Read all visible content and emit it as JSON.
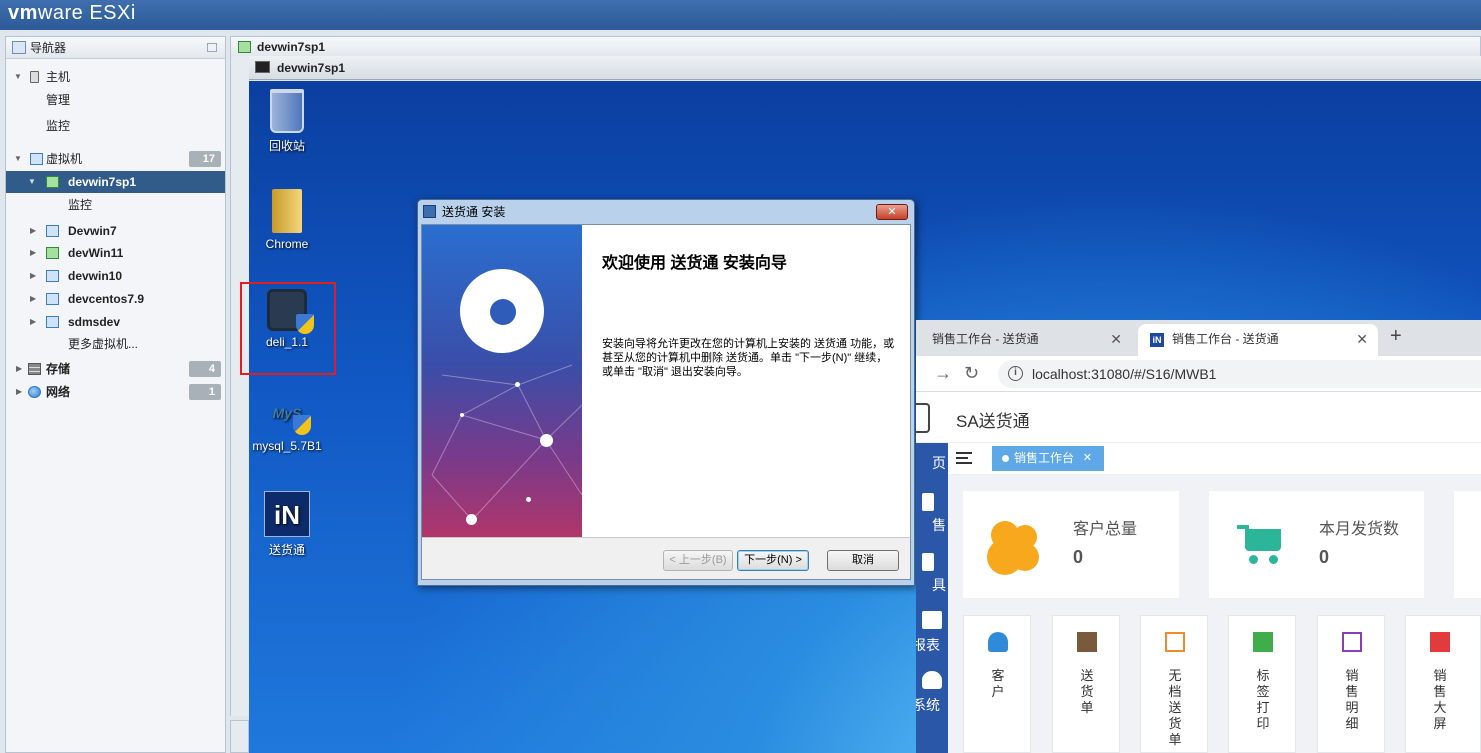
{
  "brand": {
    "vm": "vm",
    "ware": "ware",
    "product": "ESXi"
  },
  "navigator": {
    "title": "导航器",
    "host": {
      "label": "主机",
      "children": [
        "管理",
        "监控"
      ]
    },
    "vms": {
      "label": "虚拟机",
      "count": "17",
      "selected": "devwin7sp1",
      "selected_child": "监控",
      "items": [
        "Devwin7",
        "devWin11",
        "devwin10",
        "devcentos7.9",
        "sdmsdev"
      ],
      "more": "更多虚拟机..."
    },
    "storage": {
      "label": "存储",
      "count": "4"
    },
    "network": {
      "label": "网络",
      "count": "1"
    }
  },
  "vm_panel": {
    "tab_title": "devwin7sp1",
    "console_title": "devwin7sp1"
  },
  "desktop": {
    "icons": [
      "回收站",
      "Chrome",
      "deli_1.1",
      "mysql_5.7B1",
      "送货通"
    ],
    "mysql_logo": "MyS",
    "app_logo": "iN"
  },
  "installer": {
    "title": "送货通 安装",
    "close": "✕",
    "heading": "欢迎使用 送货通 安装向导",
    "body": "安装向导将允许更改在您的计算机上安装的 送货通 功能，或甚至从您的计算机中删除 送货通。单击 \"下一步(N)\" 继续，或单击 \"取消\" 退出安装向导。",
    "buttons": {
      "back": "< 上一步(B)",
      "next": "下一步(N) >",
      "cancel": "取消"
    }
  },
  "browser": {
    "tabs": [
      {
        "title": "销售工作台 - 送货通"
      },
      {
        "title": "销售工作台 - 送货通"
      }
    ],
    "tab_close": "✕",
    "new_tab": "+",
    "url": "localhost:31080/#/S16/MWB1",
    "app_title": "SA送货通",
    "side": [
      "页",
      "售",
      "具",
      "报表",
      "系统"
    ],
    "active_tab": "销售工作台",
    "stats": [
      {
        "label": "客户总量",
        "value": "0"
      },
      {
        "label": "本月发货数",
        "value": "0"
      }
    ],
    "quick": [
      {
        "label": "客户",
        "color": "#2f8bd8"
      },
      {
        "label": "送货单",
        "color": "#7a5a3a"
      },
      {
        "label": "无档送货单",
        "color": "#f08a2a"
      },
      {
        "label": "标签打印",
        "color": "#3fae4a"
      },
      {
        "label": "销售明细",
        "color": "#8a3fb8"
      },
      {
        "label": "销售大屏",
        "color": "#e23b3b"
      }
    ]
  }
}
